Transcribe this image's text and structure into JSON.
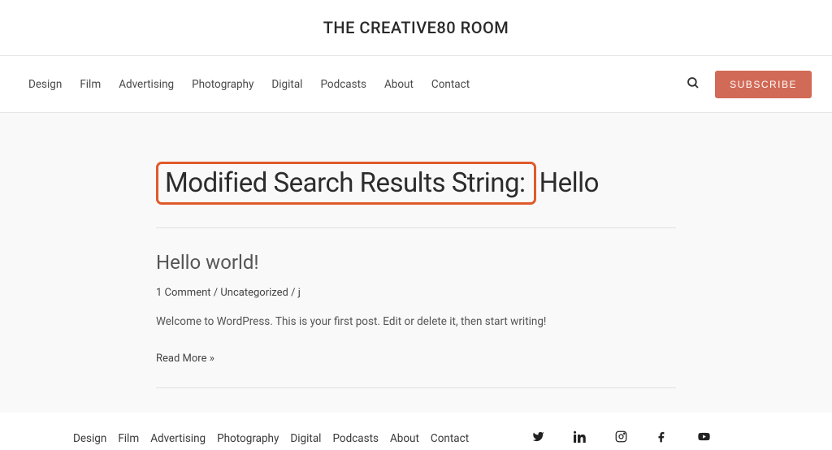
{
  "site_title": "THE CREATIVE80 ROOM",
  "nav": {
    "items": [
      "Design",
      "Film",
      "Advertising",
      "Photography",
      "Digital",
      "Podcasts",
      "About",
      "Contact"
    ]
  },
  "subscribe_label": "SUBSCRIBE",
  "search_results": {
    "prefix": "Modified Search Results String:",
    "term": "Hello"
  },
  "post": {
    "title": "Hello world!",
    "comments": "1 Comment",
    "sep1": " / ",
    "category": "Uncategorized",
    "sep2": " / ",
    "author": "j",
    "excerpt": "Welcome to WordPress. This is your first post. Edit or delete it, then start writing!",
    "read_more": "Read More »"
  },
  "footer_nav": {
    "items": [
      "Design",
      "Film",
      "Advertising",
      "Photography",
      "Digital",
      "Podcasts",
      "About",
      "Contact"
    ]
  }
}
